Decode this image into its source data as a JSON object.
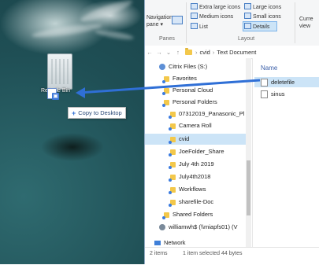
{
  "desktop": {
    "recycle_bin_label": "Recycle Bin",
    "drag_tooltip": {
      "symbol": "+",
      "label": "Copy to Desktop"
    }
  },
  "ribbon": {
    "navigation_pane": "Navigation pane ▾",
    "extra_large_icons": "Extra large icons",
    "large_icons": "Large icons",
    "medium_icons": "Medium icons",
    "small_icons": "Small icons",
    "list": "List",
    "details": "Details",
    "current_view": "Curre view",
    "groups": {
      "panes": "Panes",
      "layout": "Layout"
    }
  },
  "address": {
    "back": "←",
    "forward": "→",
    "dropdown": "⌄",
    "up": "↑",
    "crumbs": [
      "cvid",
      "Text Document"
    ],
    "separator": "›"
  },
  "nav_items": [
    {
      "label": "Citrix Files (S:)",
      "icon": "drive-icon"
    },
    {
      "label": "Favorites",
      "icon": "sharefile-folder-icon"
    },
    {
      "label": "Personal Cloud",
      "icon": "sharefile-folder-icon"
    },
    {
      "label": "Personal Folders",
      "icon": "sharefile-folder-icon"
    },
    {
      "label": "07312019_Panasonic_Pl",
      "icon": "sharefile-folder-icon"
    },
    {
      "label": "Camera Roll",
      "icon": "sharefile-folder-icon"
    },
    {
      "label": "cvid",
      "icon": "sharefile-folder-icon",
      "selected": true
    },
    {
      "label": "JoeFolder_Share",
      "icon": "sharefile-folder-icon"
    },
    {
      "label": "July 4th 2019",
      "icon": "sharefile-folder-icon"
    },
    {
      "label": "July4th2018",
      "icon": "sharefile-folder-icon"
    },
    {
      "label": "Workflows",
      "icon": "sharefile-folder-icon"
    },
    {
      "label": "sharefile-Doc",
      "icon": "sharefile-folder-icon"
    },
    {
      "label": "Shared Folders",
      "icon": "sharefile-folder-icon"
    },
    {
      "label": "williamwh$ (\\\\miapfs01) (V",
      "icon": "network-drive-icon"
    },
    {
      "label": "Network",
      "icon": "network-icon"
    }
  ],
  "content": {
    "column_name": "Name",
    "files": [
      {
        "name": "deletefile",
        "selected": true
      },
      {
        "name": "sinus",
        "selected": false
      }
    ]
  },
  "status": {
    "item_count": "2 items",
    "selection": "1 item selected  44 bytes"
  },
  "colors": {
    "selection": "#cce4f7",
    "drag_arrow": "#2f6fd6"
  }
}
